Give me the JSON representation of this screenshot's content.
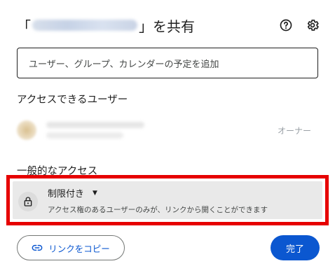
{
  "dialog": {
    "title_prefix": "「",
    "title_suffix": "」を共有",
    "help_icon": "help-circle-icon",
    "settings_icon": "gear-icon"
  },
  "add_input": {
    "placeholder": "ユーザー、グループ、カレンダーの予定を追加"
  },
  "people": {
    "heading": "アクセスできるユーザー",
    "items": [
      {
        "role": "オーナー"
      }
    ]
  },
  "general_access": {
    "heading": "一般的なアクセス",
    "mode": "制限付き",
    "description": "アクセス権のあるユーザーのみが、リンクから開くことができます",
    "lock_icon": "lock-icon",
    "highlight_color": "#e60000"
  },
  "footer": {
    "copy_link_label": "リンクをコピー",
    "done_label": "完了",
    "accent": "#0b57d0"
  }
}
